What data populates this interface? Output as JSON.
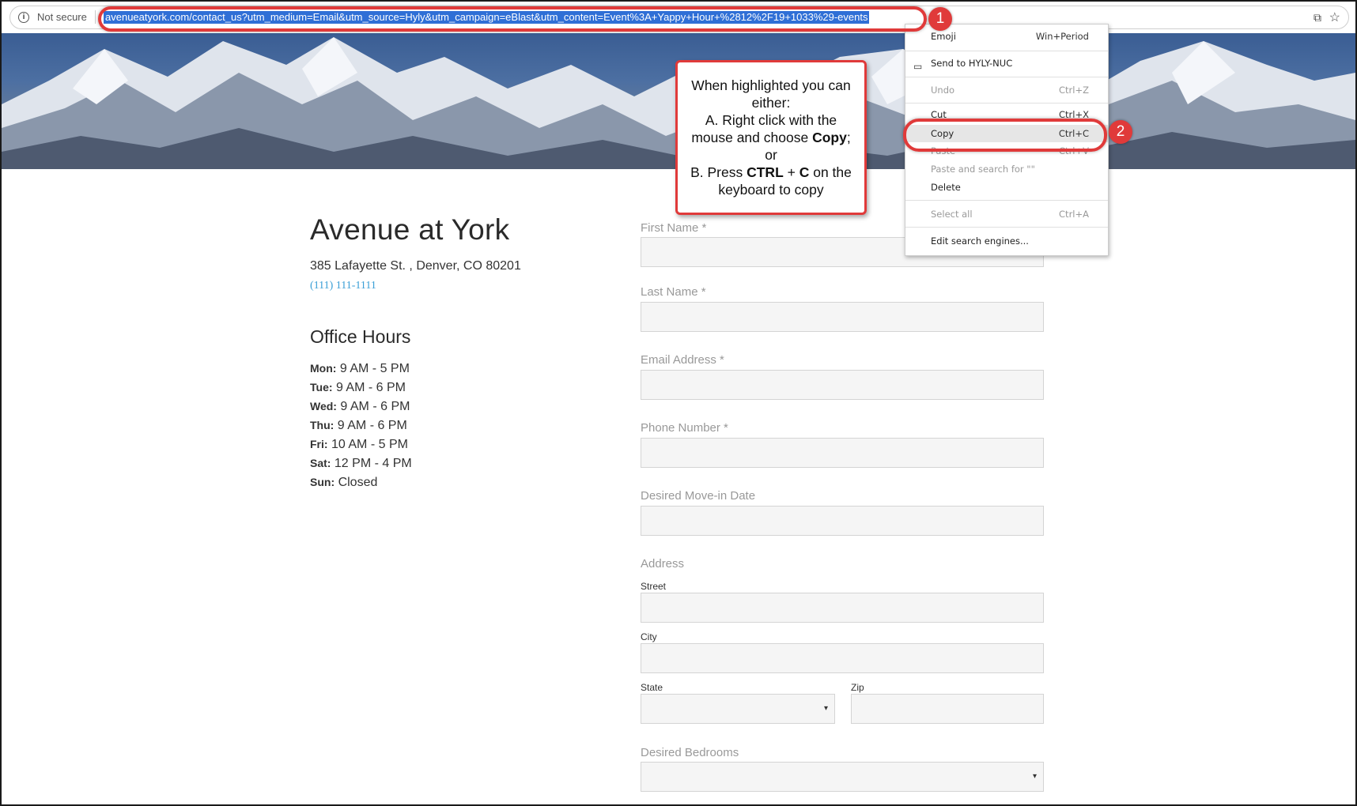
{
  "browser": {
    "security_label": "Not secure",
    "info_icon": "info-icon",
    "url": "avenueatyork.com/contact_us?utm_medium=Email&utm_source=Hyly&utm_campaign=eBlast&utm_content=Event%3A+Yappy+Hour+%2812%2F19+1033%29-events",
    "cast_glyph": "⧉",
    "star_glyph": "☆"
  },
  "venue": {
    "name": "Avenue at York",
    "address": "385 Lafayette St. , Denver, CO 80201",
    "phone": "(111) 111-1111"
  },
  "office_hours": {
    "title": "Office Hours",
    "rows": [
      {
        "day": "Mon:",
        "hours": "9 AM - 5 PM"
      },
      {
        "day": "Tue:",
        "hours": "9 AM - 6 PM"
      },
      {
        "day": "Wed:",
        "hours": "9 AM - 6 PM"
      },
      {
        "day": "Thu:",
        "hours": "9 AM - 6 PM"
      },
      {
        "day": "Fri:",
        "hours": "10 AM - 5 PM"
      },
      {
        "day": "Sat:",
        "hours": "12 PM - 4 PM"
      },
      {
        "day": "Sun:",
        "hours": "Closed"
      }
    ]
  },
  "form": {
    "first_name": "First Name *",
    "last_name": "Last Name *",
    "email": "Email Address *",
    "phone": "Phone Number *",
    "move_in": "Desired Move-in Date",
    "address": "Address",
    "street": "Street",
    "city": "City",
    "state": "State",
    "zip": "Zip",
    "bedrooms": "Desired Bedrooms",
    "select_arrow": "▾"
  },
  "callout": {
    "line1": "When highlighted you can either:",
    "line2_pre": "A. Right click with the mouse and choose ",
    "line2_bold": "Copy",
    "line2_post": ";",
    "or": "or",
    "line3_pre": "B. Press ",
    "line3_bold1": "CTRL",
    "line3_mid": " + ",
    "line3_bold2": "C",
    "line3_post": " on the keyboard to copy"
  },
  "context_menu": {
    "emoji": {
      "label": "Emoji",
      "shortcut": "Win+Period"
    },
    "send": {
      "label": "Send to HYLY-NUC",
      "icon": "send-to-device-icon"
    },
    "undo": {
      "label": "Undo",
      "shortcut": "Ctrl+Z"
    },
    "cut": {
      "label": "Cut",
      "shortcut": "Ctrl+X"
    },
    "copy": {
      "label": "Copy",
      "shortcut": "Ctrl+C"
    },
    "paste": {
      "label": "Paste",
      "shortcut": "Ctrl+V"
    },
    "paste_search": {
      "label": "Paste and search for \"\""
    },
    "delete": {
      "label": "Delete"
    },
    "select_all": {
      "label": "Select all",
      "shortcut": "Ctrl+A"
    },
    "edit_search": {
      "label": "Edit search engines..."
    }
  },
  "annotations": {
    "step1": "1",
    "step2": "2",
    "color": "#e03a3a"
  },
  "colors": {
    "url_highlight": "#2f6fd6",
    "link": "#3a9fd6",
    "input_bg": "#f5f5f5"
  }
}
